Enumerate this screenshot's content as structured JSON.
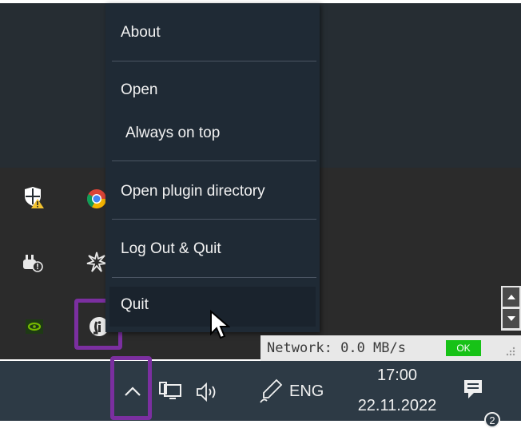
{
  "menu": {
    "items": [
      {
        "label": "About"
      },
      {
        "label": "Open"
      },
      {
        "label": "Always on top"
      },
      {
        "label": "Open plugin directory"
      },
      {
        "label": "Log Out & Quit"
      },
      {
        "label": "Quit"
      }
    ]
  },
  "tray": {
    "icons": [
      "security-warning-icon",
      "chrome-icon",
      "plug-icon",
      "spark-icon",
      "nvidia-icon",
      "info-app-icon"
    ]
  },
  "network": {
    "text": "Network: 0.0 MB/s",
    "status": "OK",
    "status_color": "#17c217"
  },
  "taskbar": {
    "language": "ENG",
    "time": "17:00",
    "date": "22.11.2022",
    "notification_count": "2"
  },
  "colors": {
    "highlight": "#7b2fa0",
    "menu_bg": "#1f2a35",
    "taskbar_bg": "#2d3a45"
  }
}
